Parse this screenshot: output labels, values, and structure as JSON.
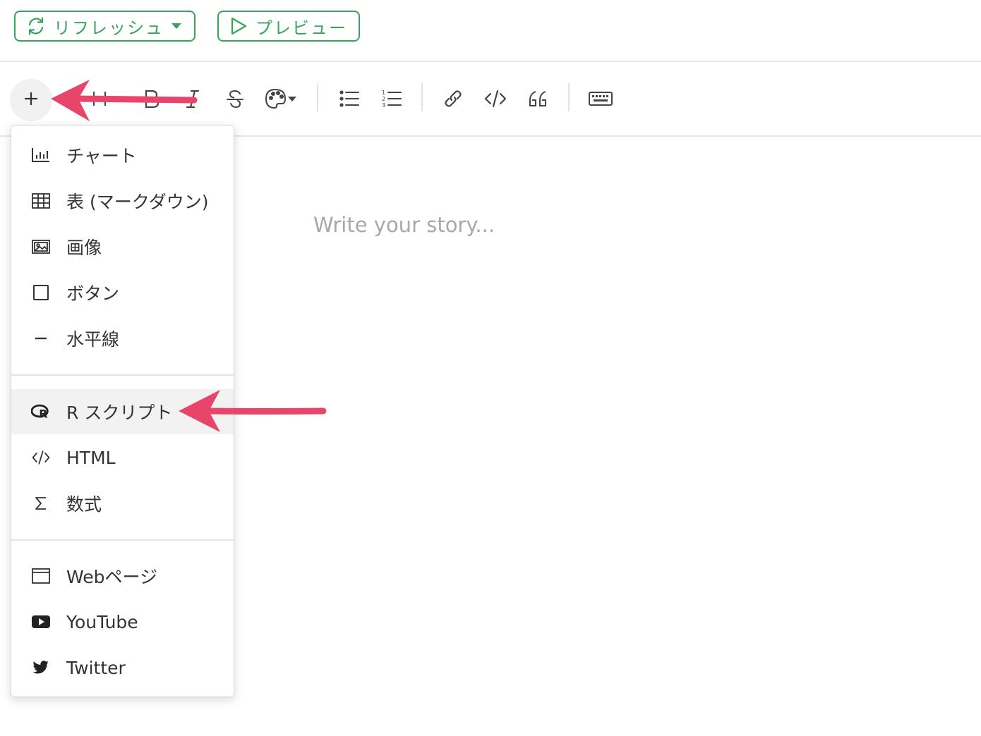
{
  "header": {
    "refresh_label": "リフレッシュ",
    "preview_label": "プレビュー"
  },
  "editor": {
    "placeholder": "Write your story..."
  },
  "insert_menu": {
    "items": [
      {
        "label": "チャート",
        "icon": "bar-chart-icon"
      },
      {
        "label": "表 (マークダウン)",
        "icon": "table-icon"
      },
      {
        "label": "画像",
        "icon": "image-icon"
      },
      {
        "label": "ボタン",
        "icon": "square-icon"
      },
      {
        "label": "水平線",
        "icon": "horizontal-line-icon"
      },
      {
        "label": "R スクリプト",
        "icon": "r-logo-icon"
      },
      {
        "label": "HTML",
        "icon": "code-icon"
      },
      {
        "label": "数式",
        "icon": "sigma-icon"
      },
      {
        "label": "Webページ",
        "icon": "browser-window-icon"
      },
      {
        "label": "YouTube",
        "icon": "youtube-icon"
      },
      {
        "label": "Twitter",
        "icon": "twitter-icon"
      }
    ]
  },
  "colors": {
    "accent_green": "#3aa35a",
    "annotation_arrow": "#e8456b",
    "placeholder_text": "#a8a8a8"
  }
}
